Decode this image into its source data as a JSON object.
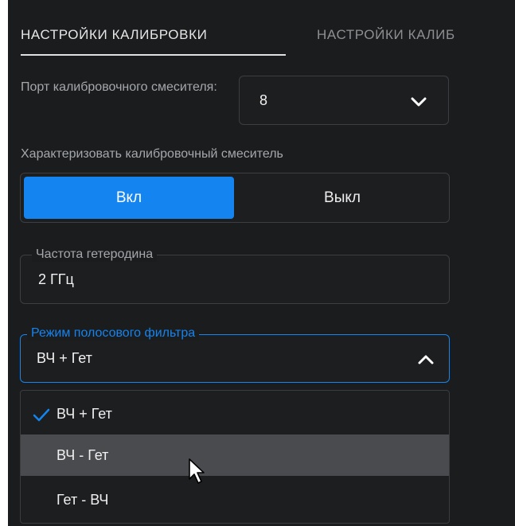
{
  "tabs": [
    {
      "label": "НАСТРОЙКИ КАЛИБРОВКИ",
      "active": true
    },
    {
      "label": "НАСТРОЙКИ КАЛИБ",
      "active": false
    }
  ],
  "port": {
    "label": "Порт калибровочного смесителя:",
    "value": "8"
  },
  "characterize": {
    "label": "Характеризовать калибровочный смеситель",
    "on_label": "Вкл",
    "off_label": "Выкл",
    "selected": "Вкл"
  },
  "lo_freq": {
    "label": "Частота гетеродина",
    "value": "2 ГГц"
  },
  "bandpass": {
    "label": "Режим полосового фильтра",
    "value": "ВЧ + Гет"
  },
  "dropdown": {
    "options": [
      "ВЧ + Гет",
      "ВЧ - Гет",
      "Гет - ВЧ"
    ],
    "selected": "ВЧ + Гет",
    "hovered": "ВЧ - Гет"
  },
  "colors": {
    "accent": "#1484f0",
    "background": "#1b1c1d",
    "hover": "#4a4b4e"
  },
  "icons": {
    "select": "chevron-down-icon",
    "open_select": "chevron-up-icon",
    "selected_option": "checkmark-icon",
    "pointer": "mouse-cursor-icon"
  }
}
